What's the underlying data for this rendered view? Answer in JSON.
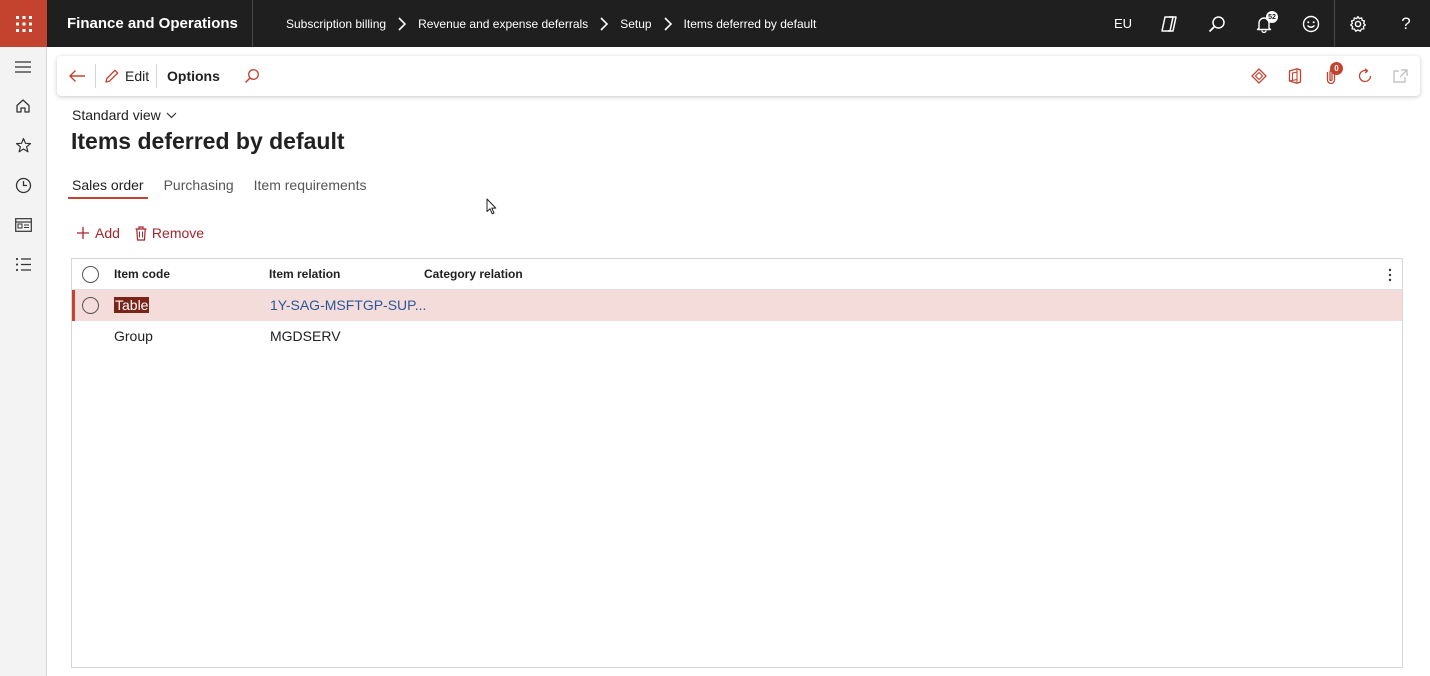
{
  "topbar": {
    "app_title": "Finance and Operations",
    "breadcrumb": [
      "Subscription billing",
      "Revenue and expense deferrals",
      "Setup",
      "Items deferred by default"
    ],
    "company": "EU",
    "notification_count": "52",
    "icons": [
      "waffle-icon",
      "copilot-icon",
      "search-icon",
      "bell-icon",
      "smiley-icon",
      "gear-icon",
      "help-icon"
    ]
  },
  "leftnav": {
    "icons": [
      "hamburger-icon",
      "home-icon",
      "star-icon",
      "clock-icon",
      "workspace-icon",
      "modules-icon"
    ]
  },
  "actionpane": {
    "edit_label": "Edit",
    "options_label": "Options",
    "attachments_count": "0",
    "icons": [
      "back-arrow-icon",
      "pencil-icon",
      "search-icon",
      "power-apps-icon",
      "office-icon",
      "attachment-icon",
      "refresh-icon",
      "open-new-window-icon"
    ]
  },
  "page": {
    "view_name": "Standard view",
    "title": "Items deferred by default",
    "tabs": [
      {
        "label": "Sales order",
        "active": true
      },
      {
        "label": "Purchasing",
        "active": false
      },
      {
        "label": "Item requirements",
        "active": false
      }
    ]
  },
  "grid_actions": {
    "add_label": "Add",
    "remove_label": "Remove"
  },
  "grid": {
    "columns": [
      "Item code",
      "Item relation",
      "Category relation"
    ],
    "rows": [
      {
        "item_code": "Table",
        "item_relation": "1Y-SAG-MSFTGP-SUP...",
        "category_relation": "",
        "selected": true
      },
      {
        "item_code": "Group",
        "item_relation": "MGDSERV",
        "category_relation": "",
        "selected": false
      }
    ]
  },
  "colors": {
    "accent": "#c3432f",
    "topbar_bg": "#1f1f1f",
    "selected_row": "#f3dcda",
    "link": "#2b579a"
  }
}
